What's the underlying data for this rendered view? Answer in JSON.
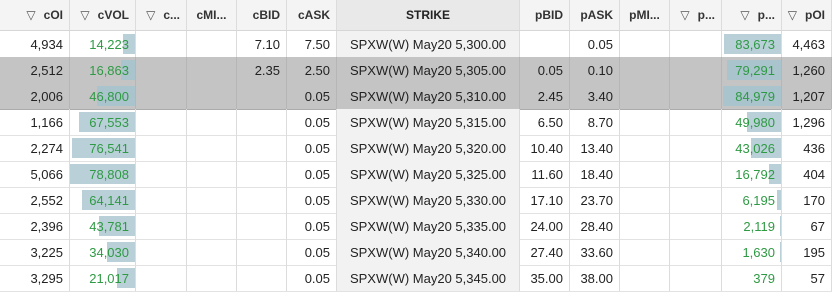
{
  "headers": [
    "cOI",
    "cVOL",
    "c...",
    "cMI...",
    "cBID",
    "cASK",
    "STRIKE",
    "pBID",
    "pASK",
    "pMI...",
    "p...",
    "p...",
    "pOI"
  ],
  "filter_icon": "filter-icon",
  "colors": {
    "volume_text": "#2f9a44",
    "volume_bar": "#b9d0d8",
    "selected_row": "#c4c4c4"
  },
  "rows": [
    {
      "cOI": "4,934",
      "cVOL": "14,223",
      "cBID": "7.10",
      "cASK": "7.50",
      "strike": "SPXW(W) May20 5,300.00",
      "pBID": "",
      "pASK": "0.05",
      "pVOL": "83,673",
      "pOI": "4,463",
      "cvol_level": 0.18,
      "pvol_level": 0.97,
      "selected": false
    },
    {
      "cOI": "2,512",
      "cVOL": "16,863",
      "cBID": "2.35",
      "cASK": "2.50",
      "strike": "SPXW(W) May20 5,305.00",
      "pBID": "0.05",
      "pASK": "0.10",
      "pVOL": "79,291",
      "pOI": "1,260",
      "cvol_level": 0.21,
      "pvol_level": 0.92,
      "selected": true
    },
    {
      "cOI": "2,006",
      "cVOL": "46,800",
      "cBID": "",
      "cASK": "0.05",
      "strike": "SPXW(W) May20 5,310.00",
      "pBID": "2.45",
      "pASK": "3.40",
      "pVOL": "84,979",
      "pOI": "1,207",
      "cvol_level": 0.59,
      "pvol_level": 0.99,
      "selected": true
    },
    {
      "cOI": "1,166",
      "cVOL": "67,553",
      "cBID": "",
      "cASK": "0.05",
      "strike": "SPXW(W) May20 5,315.00",
      "pBID": "6.50",
      "pASK": "8.70",
      "pVOL": "49,980",
      "pOI": "1,296",
      "cvol_level": 0.86,
      "pvol_level": 0.58,
      "selected": false
    },
    {
      "cOI": "2,274",
      "cVOL": "76,541",
      "cBID": "",
      "cASK": "0.05",
      "strike": "SPXW(W) May20 5,320.00",
      "pBID": "10.40",
      "pASK": "13.40",
      "pVOL": "43,026",
      "pOI": "436",
      "cvol_level": 0.97,
      "pvol_level": 0.5,
      "selected": false
    },
    {
      "cOI": "5,066",
      "cVOL": "78,808",
      "cBID": "",
      "cASK": "0.05",
      "strike": "SPXW(W) May20 5,325.00",
      "pBID": "11.60",
      "pASK": "18.40",
      "pVOL": "16,792",
      "pOI": "404",
      "cvol_level": 1.0,
      "pvol_level": 0.2,
      "selected": false
    },
    {
      "cOI": "2,552",
      "cVOL": "64,141",
      "cBID": "",
      "cASK": "0.05",
      "strike": "SPXW(W) May20 5,330.00",
      "pBID": "17.10",
      "pASK": "23.70",
      "pVOL": "6,195",
      "pOI": "170",
      "cvol_level": 0.81,
      "pvol_level": 0.07,
      "selected": false
    },
    {
      "cOI": "2,396",
      "cVOL": "43,781",
      "cBID": "",
      "cASK": "0.05",
      "strike": "SPXW(W) May20 5,335.00",
      "pBID": "24.00",
      "pASK": "28.40",
      "pVOL": "2,119",
      "pOI": "67",
      "cvol_level": 0.56,
      "pvol_level": 0.02,
      "selected": false
    },
    {
      "cOI": "3,225",
      "cVOL": "34,030",
      "cBID": "",
      "cASK": "0.05",
      "strike": "SPXW(W) May20 5,340.00",
      "pBID": "27.40",
      "pASK": "33.60",
      "pVOL": "1,630",
      "pOI": "195",
      "cvol_level": 0.43,
      "pvol_level": 0.02,
      "selected": false
    },
    {
      "cOI": "3,295",
      "cVOL": "21,017",
      "cBID": "",
      "cASK": "0.05",
      "strike": "SPXW(W) May20 5,345.00",
      "pBID": "35.00",
      "pASK": "38.00",
      "pVOL": "379",
      "pOI": "57",
      "cvol_level": 0.27,
      "pvol_level": 0.0,
      "selected": false
    }
  ]
}
